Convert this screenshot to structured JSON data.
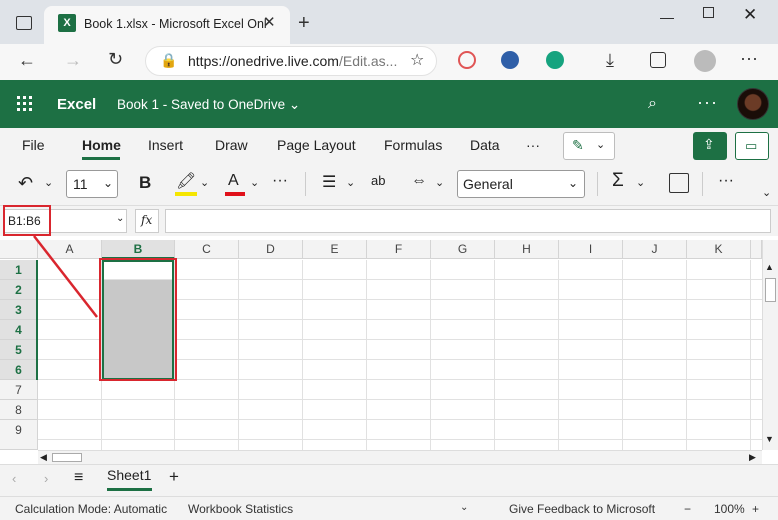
{
  "browser": {
    "tab_title": "Book 1.xlsx - Microsoft Excel Onl",
    "tab_icon_letter": "X",
    "url_main": "https://onedrive.live.com",
    "url_rest": "/Edit.as..."
  },
  "app": {
    "name": "Excel",
    "doc_title": "Book 1 - Saved to OneDrive ⌄",
    "header_color": "#1d7044"
  },
  "ribbon": {
    "tabs": [
      "File",
      "Home",
      "Insert",
      "Draw",
      "Page Layout",
      "Formulas",
      "Data"
    ],
    "active_tab": "Home",
    "font_size": "11",
    "number_format": "General"
  },
  "formula_bar": {
    "name_box": "B1:B6",
    "fx": "fx",
    "value": ""
  },
  "grid": {
    "columns": [
      "A",
      "B",
      "C",
      "D",
      "E",
      "F",
      "G",
      "H",
      "I",
      "J",
      "K"
    ],
    "rows": [
      "1",
      "2",
      "3",
      "4",
      "5",
      "6",
      "7",
      "8",
      "9"
    ],
    "selected_column": "B",
    "selected_rows": [
      "1",
      "2",
      "3",
      "4",
      "5",
      "6"
    ],
    "selection_range": "B1:B6"
  },
  "sheets": {
    "tabs": [
      "Sheet1"
    ],
    "active": "Sheet1"
  },
  "status": {
    "calc_mode": "Calculation Mode: Automatic",
    "workbook_stats": "Workbook Statistics",
    "feedback": "Give Feedback to Microsoft",
    "zoom": "100%",
    "zoom_minus": "−",
    "zoom_plus": "+"
  },
  "annotation_color": "#d9262e"
}
